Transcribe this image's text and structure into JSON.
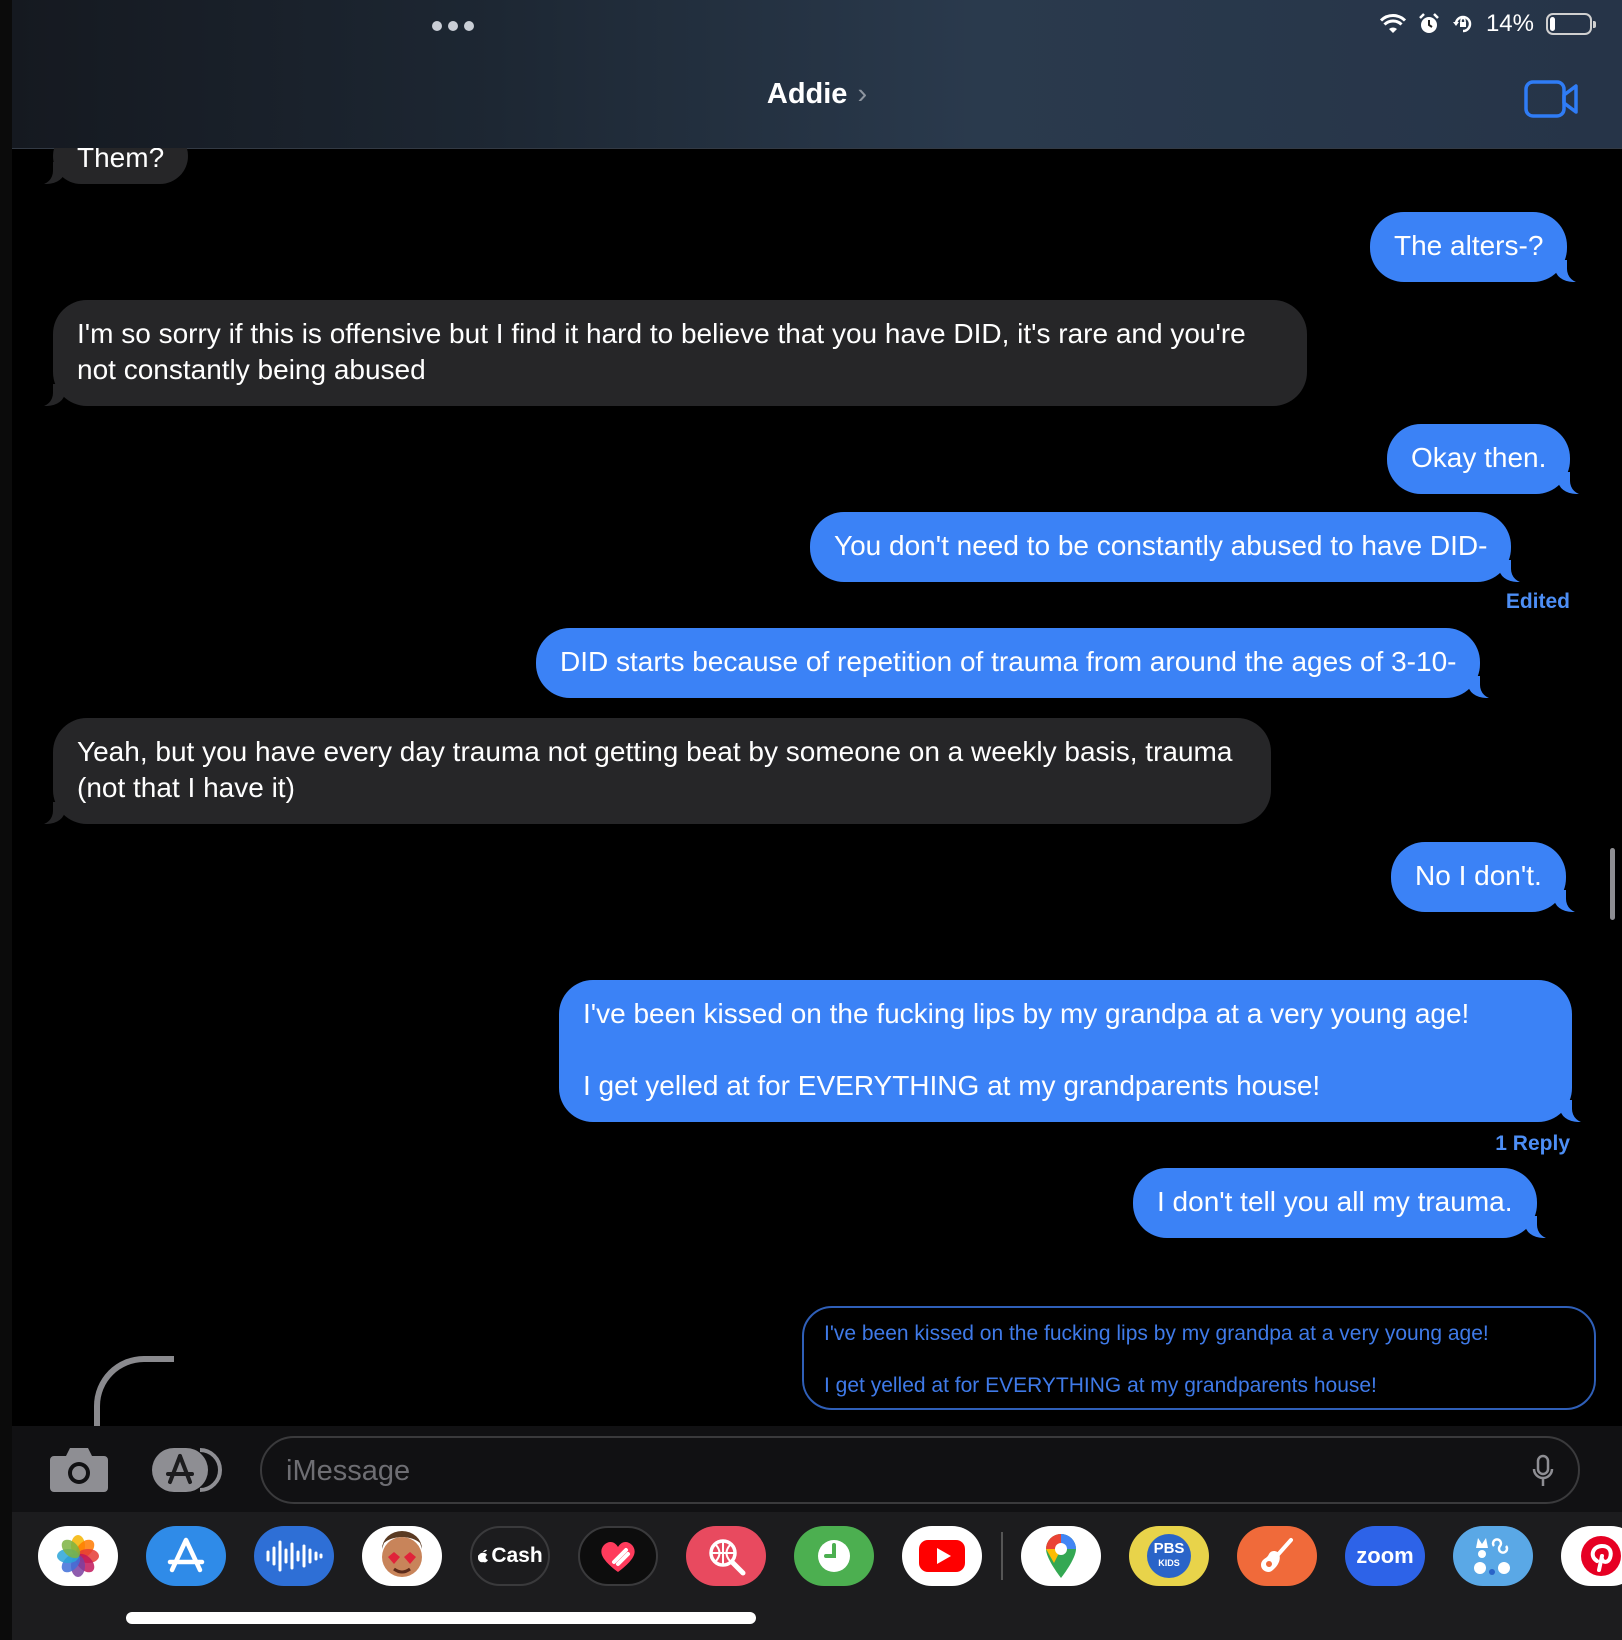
{
  "status_bar": {
    "battery_text": "14%",
    "battery_level": 0.14
  },
  "header": {
    "contact_name": "Addie",
    "chevron": "›"
  },
  "messages": [
    {
      "text": "Them?"
    },
    {
      "text": "The alters-?"
    },
    {
      "text": "I'm so sorry if this is offensive but I find it hard to believe that you have DID, it's rare and you're not constantly being abused"
    },
    {
      "text": "Okay then."
    },
    {
      "text": "You don't need to be constantly abused to have DID-"
    },
    {
      "text": "DID starts because of repetition of trauma from around the ages of 3-10-"
    },
    {
      "text": "Yeah, but you have every day trauma not getting beat by someone on a weekly basis, trauma (not that I have it)"
    },
    {
      "text": "No I don't."
    },
    {
      "line1": "I've been kissed on the fucking lips by my grandpa at a very young age!",
      "line2": "I get yelled at for EVERYTHING at my grandparents house!"
    },
    {
      "text": "I don't tell you all my trauma."
    }
  ],
  "edited_label": "Edited",
  "reply_count_label": "1 Reply",
  "reply_preview": {
    "line1": "I've been kissed on the fucking lips by my grandpa at a very young age!",
    "line2": "I get yelled at for EVERYTHING at my grandparents house!"
  },
  "composer": {
    "placeholder": "iMessage"
  },
  "dock": {
    "apps": [
      {
        "icon": "photos-icon"
      },
      {
        "icon": "app-store-icon"
      },
      {
        "icon": "soundwave-icon"
      },
      {
        "icon": "memoji-stickers-icon"
      },
      {
        "icon": "apple-cash-icon",
        "label": "Cash"
      },
      {
        "icon": "heart-stickers-icon"
      },
      {
        "icon": "web-search-icon"
      },
      {
        "icon": "clock-icon"
      },
      {
        "icon": "youtube-icon"
      },
      {
        "icon": "google-maps-icon"
      },
      {
        "icon": "pbs-kids-icon",
        "label": "PBS",
        "sublabel": "KIDS"
      },
      {
        "icon": "garageband-icon"
      },
      {
        "icon": "zoom-icon",
        "label": "zoom"
      },
      {
        "icon": "game-pigeon-icon"
      },
      {
        "icon": "pinterest-icon"
      }
    ]
  },
  "colors": {
    "outgoing": "#3b82f6",
    "incoming": "#262628",
    "accent": "#4d8ef5"
  }
}
